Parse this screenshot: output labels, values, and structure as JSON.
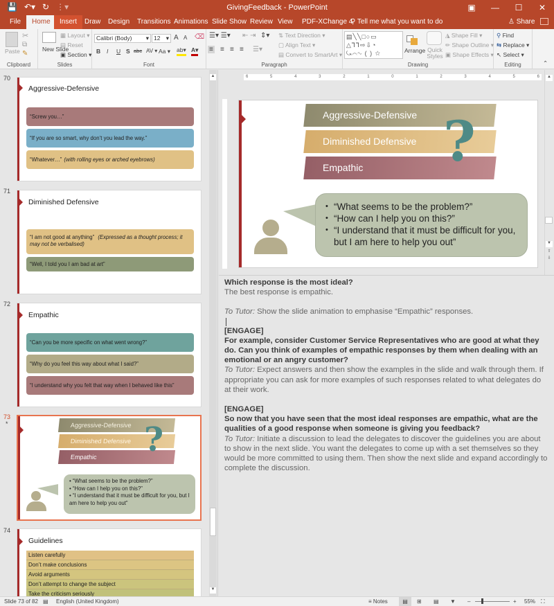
{
  "app": {
    "title": "GivingFeedback - PowerPoint",
    "qat_icons": [
      "save-icon",
      "undo-icon",
      "redo-icon",
      "customize-icon"
    ],
    "window_controls": [
      "ribbon-display-icon",
      "minimize-icon",
      "maximize-icon",
      "close-icon"
    ]
  },
  "tabs": [
    {
      "label": "File"
    },
    {
      "label": "Home",
      "active": true
    },
    {
      "label": "Insert"
    },
    {
      "label": "Draw"
    },
    {
      "label": "Design"
    },
    {
      "label": "Transitions"
    },
    {
      "label": "Animations"
    },
    {
      "label": "Slide Show"
    },
    {
      "label": "Review"
    },
    {
      "label": "View"
    },
    {
      "label": "PDF-XChange 4"
    }
  ],
  "tell_me": "Tell me what you want to do",
  "share": "Share",
  "ribbon": {
    "clipboard": {
      "label": "Clipboard",
      "paste": "Paste"
    },
    "slides": {
      "label": "Slides",
      "new_slide": "New Slide",
      "layout": "Layout",
      "reset": "Reset",
      "section": "Section"
    },
    "font": {
      "label": "Font",
      "font_name": "Calibri (Body)",
      "font_size": "12",
      "bold": "B",
      "italic": "I",
      "underline": "U",
      "shadow": "S",
      "strike": "abc",
      "spacing": "AV",
      "case": "Aa",
      "grow": "A",
      "shrink": "A"
    },
    "paragraph": {
      "label": "Paragraph",
      "text_direction": "Text Direction",
      "align_text": "Align Text",
      "convert_smartart": "Convert to SmartArt"
    },
    "drawing": {
      "label": "Drawing",
      "arrange": "Arrange",
      "quick_styles": "Quick Styles",
      "shape_fill": "Shape Fill",
      "shape_outline": "Shape Outline",
      "shape_effects": "Shape Effects"
    },
    "editing": {
      "label": "Editing",
      "find": "Find",
      "replace": "Replace",
      "select": "Select"
    }
  },
  "thumbnails": [
    {
      "num": "70",
      "title": "Aggressive-Defensive",
      "items": [
        {
          "text": "“Screw you…”",
          "italic": "",
          "color": "#a87a7a"
        },
        {
          "text": "“If you are so smart, why don’t you lead the way.”",
          "italic": "",
          "color": "#7aafc8"
        },
        {
          "text": "“Whatever…”",
          "italic": "(with rolling eyes or arched eyebrows)",
          "color": "#e0c185"
        }
      ]
    },
    {
      "num": "71",
      "title": "Diminished Defensive",
      "items": [
        {
          "text": "“I am not good at anything”",
          "italic": "(Expressed as a thought process; it may not be verbalised)",
          "color": "#e0c185"
        },
        {
          "text": "“Well, I told you I am bad at art”",
          "italic": "",
          "color": "#8e9a78"
        }
      ]
    },
    {
      "num": "72",
      "title": "Empathic",
      "items": [
        {
          "text": "“Can you be more specific on what went wrong?”",
          "italic": "",
          "color": "#6fa39d"
        },
        {
          "text": "“Why do you feel this way about what I said?”",
          "italic": "",
          "color": "#b2ab88"
        },
        {
          "text": "“I understand why you felt that way when I behaved like this”",
          "italic": "",
          "color": "#a87a7a"
        }
      ]
    },
    {
      "num": "73",
      "selected": true,
      "star": "*"
    },
    {
      "num": "74",
      "title": "Guidelines",
      "items": [
        {
          "text": "Listen carefully",
          "color": "#e0c185"
        },
        {
          "text": "Don’t make conclusions",
          "color": "#dcc583"
        },
        {
          "text": "Avoid arguments",
          "color": "#d4c57f"
        },
        {
          "text": "Don’t attempt to change the subject",
          "color": "#cbc47d"
        },
        {
          "text": "Take the criticism seriously",
          "color": "#c1c17a"
        }
      ]
    }
  ],
  "slide": {
    "bands": [
      {
        "label": "Aggressive-Defensive",
        "color_from": "#8e8a6e",
        "color_to": "#c4b996"
      },
      {
        "label": "Diminished Defensive",
        "color_from": "#d6ad6c",
        "color_to": "#e8cc99"
      },
      {
        "label": "Empathic",
        "color_from": "#955f66",
        "color_to": "#c0898d"
      }
    ],
    "question_mark": "?",
    "bubble": [
      "“What seems to be the problem?”",
      "“How can I help you on this?”",
      "“I understand that it must be difficult for you, but I am here to help you out”"
    ]
  },
  "ruler": {
    "horizontal": [
      "6",
      "5",
      "4",
      "3",
      "2",
      "1",
      "0",
      "1",
      "2",
      "3",
      "4",
      "5",
      "6"
    ]
  },
  "notes": {
    "q1_title": "Which response is the most ideal?",
    "q1_answer": "The best response is empathic.",
    "tutor_label": "To Tutor:",
    "tutor1": " Show the slide animation to emphasise “Empathic” responses.",
    "engage": "[ENGAGE]",
    "engage1": "For example, consider Customer Service Representatives who are good at what they do. Can you think of examples of empathic responses by them when dealing with an emotional or an angry customer?",
    "tutor2": " Expect answers and then show the examples in the slide and walk through them. If appropriate you can ask for more examples of such responses related to what delegates do at their work.",
    "engage2": "So now that you have seen that the most ideal responses are empathic, what are the qualities of a good response when someone is giving you feedback?",
    "tutor3": " Initiate a discussion to lead the delegates to discover the guidelines you are about to show in the next slide. You want the delegates to come up with a set themselves so they would be more committed to using them. Then show the next slide and expand accordingly to complete the discussion."
  },
  "status": {
    "slide_info": "Slide 73 of 82",
    "language": "English (United Kingdom)",
    "notes": "Notes",
    "zoom": "55%"
  }
}
